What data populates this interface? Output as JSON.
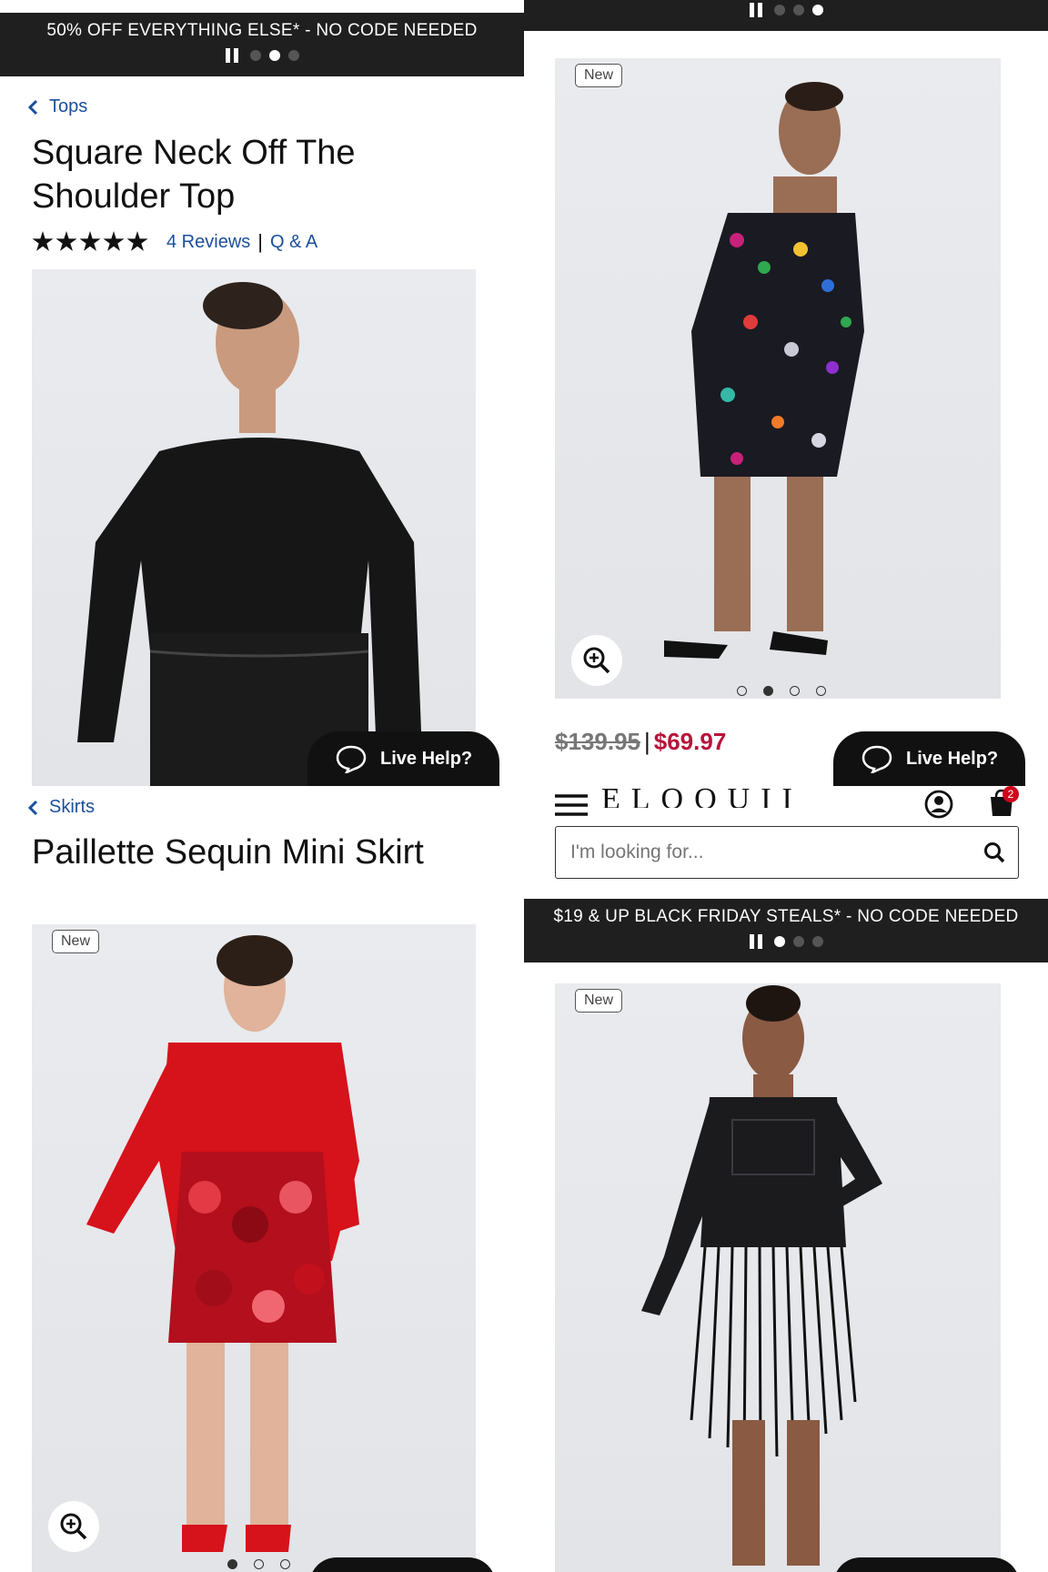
{
  "panel_top_left": {
    "promo": {
      "text": "50% OFF EVERYTHING ELSE* - NO CODE NEEDED"
    },
    "breadcrumb": {
      "label": "Tops"
    },
    "title": "Square Neck Off The Shoulder Top",
    "rating": {
      "stars": 5,
      "reviews_label": "4 Reviews",
      "separator": "|",
      "qa_label": "Q & A"
    },
    "live_help": "Live Help?"
  },
  "panel_top_right": {
    "badge": "New",
    "price": {
      "original": "$139.95",
      "separator": "|",
      "sale": "$69.97"
    },
    "live_help": "Live Help?",
    "header": {
      "logo": "ELOQUII",
      "cart_count": "2"
    },
    "search": {
      "placeholder": "I'm looking for..."
    },
    "promo": {
      "text": "$19 & UP BLACK FRIDAY STEALS* - NO CODE NEEDED"
    }
  },
  "panel_bottom_left": {
    "breadcrumb": {
      "label": "Skirts"
    },
    "title": "Paillette Sequin Mini Skirt",
    "badge": "New"
  },
  "panel_bottom_right": {
    "badge": "New"
  },
  "colors": {
    "banner_bg": "#1f1f1f",
    "link_blue": "#1b4f9c",
    "sale_red": "#b8133a",
    "cart_badge": "#d0021b"
  },
  "icons": [
    "chevron-left-icon",
    "star-icon",
    "zoom-in-icon",
    "chat-bubble-icon",
    "menu-icon",
    "account-icon",
    "cart-icon",
    "search-icon",
    "pause-icon"
  ]
}
